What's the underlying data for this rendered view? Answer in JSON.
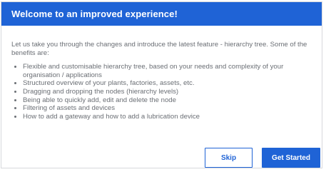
{
  "dialog": {
    "title": "Welcome to an improved experience!",
    "intro": "Let us take you through the changes and introduce the latest feature - hierarchy tree. Some of the benefits are:",
    "benefits": [
      "Flexible and customisable hierarchy tree, based on your needs and complexity of your organisation / applications",
      "Structured overview of your plants, factories, assets, etc.",
      "Dragging and dropping the nodes (hierarchy levels)",
      "Being able to quickly add, edit and delete the node",
      "Filtering of assets and devices",
      "How to add a gateway and how to add a lubrication device"
    ],
    "skip_label": "Skip",
    "start_label": "Get Started"
  },
  "colors": {
    "accent": "#1f63d6",
    "body_text": "#6b6f75",
    "border": "#d6d8dc"
  }
}
